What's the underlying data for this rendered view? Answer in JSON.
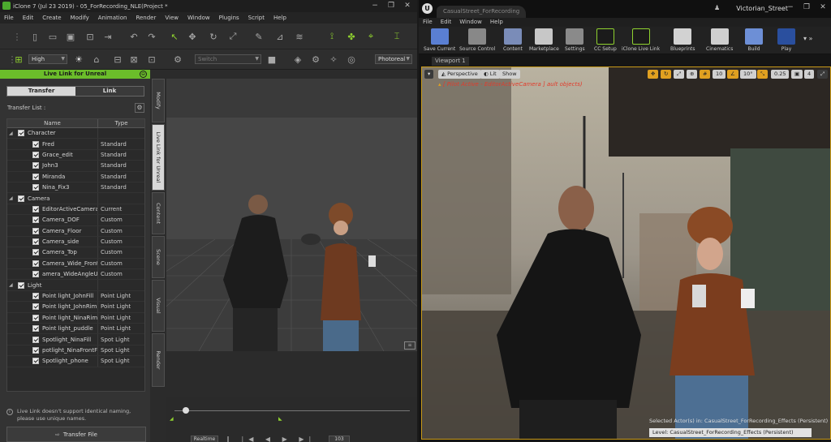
{
  "iclone": {
    "title": "iClone 7 (Jul 23 2019) - 05_ForRecording_NLE(Project *",
    "window_controls": [
      "−",
      "❐",
      "✕"
    ],
    "menu": [
      "File",
      "Edit",
      "Create",
      "Modify",
      "Animation",
      "Render",
      "View",
      "Window",
      "Plugins",
      "Script",
      "Help"
    ],
    "quality": "High",
    "switch_field": "Switch",
    "render_mode": "Photoreal",
    "live_link": {
      "panel_title": "Live Link for Unreal",
      "tabs": [
        "Transfer",
        "Link"
      ],
      "transfer_list_label": "Transfer List :",
      "columns": [
        "Name",
        "Type"
      ],
      "tree": [
        {
          "kind": "group",
          "name": "Character"
        },
        {
          "kind": "item",
          "name": "Fred",
          "type": "Standard"
        },
        {
          "kind": "item",
          "name": "Grace_edit",
          "type": "Standard"
        },
        {
          "kind": "item",
          "name": "John3",
          "type": "Standard"
        },
        {
          "kind": "item",
          "name": "Miranda",
          "type": "Standard"
        },
        {
          "kind": "item",
          "name": "Nina_Fix3",
          "type": "Standard"
        },
        {
          "kind": "group",
          "name": "Camera"
        },
        {
          "kind": "item",
          "name": "EditorActiveCamera",
          "type": "Current"
        },
        {
          "kind": "item",
          "name": "Camera_DOF",
          "type": "Custom"
        },
        {
          "kind": "item",
          "name": "Camera_Floor",
          "type": "Custom"
        },
        {
          "kind": "item",
          "name": "Camera_side",
          "type": "Custom"
        },
        {
          "kind": "item",
          "name": "Camera_Top",
          "type": "Custom"
        },
        {
          "kind": "item",
          "name": "Camera_Wide_Front",
          "type": "Custom"
        },
        {
          "kind": "item",
          "name": "amera_WideAngleUp",
          "type": "Custom"
        },
        {
          "kind": "group",
          "name": "Light"
        },
        {
          "kind": "item",
          "name": "Point light_JohnFill",
          "type": "Point Light"
        },
        {
          "kind": "item",
          "name": "Point light_JohnRim",
          "type": "Point Light"
        },
        {
          "kind": "item",
          "name": "Point light_NinaRim",
          "type": "Point Light"
        },
        {
          "kind": "item",
          "name": "Point light_puddle",
          "type": "Point Light"
        },
        {
          "kind": "item",
          "name": "Spotlight_NinaFill",
          "type": "Spot Light"
        },
        {
          "kind": "item",
          "name": "potlight_NinaFrontFill",
          "type": "Spot Light"
        },
        {
          "kind": "item",
          "name": "Spotlight_phone",
          "type": "Spot Light"
        }
      ],
      "note": "Live Link doesn't support identical naming, please use unique names.",
      "transfer_button": "Transfer File"
    },
    "side_tabs": [
      "Modify",
      "Live Link for Unreal",
      "Content",
      "Scene",
      "Visual",
      "Render"
    ],
    "timeline": {
      "realtime": "Realtime",
      "frame": "103"
    }
  },
  "unreal": {
    "tab_title": "CasualStreet_ForRecording",
    "project_name": "Victorian_Street",
    "menu": [
      "File",
      "Edit",
      "Window",
      "Help"
    ],
    "toolbar": [
      "Save Current",
      "Source Control",
      "Content",
      "Marketplace",
      "Settings",
      "CC Setup",
      "iClone Live Link",
      "Blueprints",
      "Cinematics",
      "Build",
      "Play"
    ],
    "viewport_tab": "Viewport 1",
    "view_buttons": [
      "Perspective",
      "Lit",
      "Show"
    ],
    "snap_values": [
      "10",
      "10°",
      "0.25",
      "4"
    ],
    "pilot_text": "[ Pilot Active - EditorActiveCamera ]",
    "pilot_suffix": "ault objects)",
    "selected_text": "Selected Actor(s) in:  CasualStreet_ForRecording_Effects (Persistent)",
    "level_text": "Level:  CasualStreet_ForRecording_Effects (Persistent)"
  },
  "colors": {
    "iclone_accent": "#8fd12f",
    "unreal_selection": "#c99a18",
    "pilot_red": "#e23b2b"
  }
}
